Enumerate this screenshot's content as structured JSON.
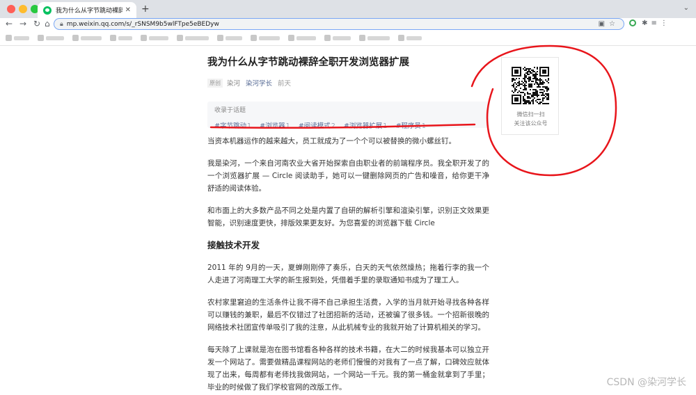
{
  "browser": {
    "tab_title": "我为什么从字节跳动裸辞全职开发...",
    "tab_close": "✕",
    "new_tab": "+",
    "url": "mp.weixin.qq.com/s/_rSNSM9b5wlFTpe5eBEDyw"
  },
  "article": {
    "title": "我为什么从字节跳动裸辞全职开发浏览器扩展",
    "original_badge": "原创",
    "author": "染河",
    "account": "染河学长",
    "date": "前天",
    "topics_label": "收录于话题",
    "topics": [
      {
        "name": "#字节跳动",
        "count": "1"
      },
      {
        "name": "#浏览器",
        "count": "1"
      },
      {
        "name": "#阅读模式",
        "count": "2"
      },
      {
        "name": "#浏览器扩展",
        "count": "1"
      },
      {
        "name": "#程序员",
        "count": "1"
      }
    ],
    "p1": "当资本机器运作的越来越大，员工就成为了一个个可以被替换的微小螺丝钉。",
    "p2": "我是染河，一个来自河南农业大省开始探索自由职业者的前端程序员。我全职开发了的一个浏览器扩展 — Circle 阅读助手，她可以一键删除网页的广告和噪音，给你更干净舒适的阅读体验。",
    "p3": "和市面上的大多数产品不同之处是内置了自研的解析引擎和渲染引擎，识别正文效果更智能，识别速度更快，排版效果更友好。为您喜爱的浏览器下载 Circle",
    "h2": "接触技术开发",
    "p4": "2011 年的 9月的一天，夏蝉刚刚停了奏乐，白天的天气依然燥热；拖着行李的我一个人走进了河南理工大学的新生报到处，凭借着手里的录取通知书成为了理工人。",
    "p5": "农村家里窘迫的生活条件让我不得不自己承担生活费，入学的当月就开始寻找各种各样可以赚钱的兼职，最后不仅错过了社团招新的活动，还被骗了很多钱。一个招新很晚的网络技术社团宣传单吸引了我的注意，从此机械专业的我就开始了计算机相关的学习。",
    "p6": "每天除了上课就是泡在图书馆看各种各样的技术书籍，在大二的时候我基本可以独立开发一个网站了。需要做精品课程网站的老师们慢慢的对我有了一点了解，口碑效应就体现了出来，每周都有老师找我做网站，一个网站一千元。我的第一桶金就拿到了手里；毕业的时候做了我们学校官网的改版工作。"
  },
  "qr_card": {
    "line1": "微信扫一扫",
    "line2": "关注该公众号"
  },
  "watermark": "CSDN @染河学长",
  "colors": {
    "link": "#576b95",
    "annotation": "#e8151b",
    "tab_strip": "#dee1e6"
  }
}
